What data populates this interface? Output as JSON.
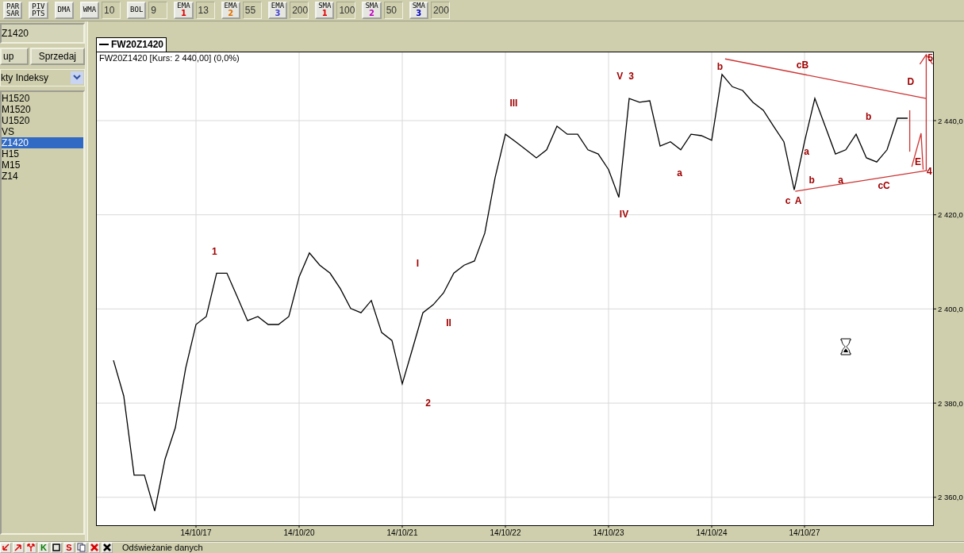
{
  "toolbar": {
    "indicators": [
      {
        "lines": [
          "PAR",
          "SAR"
        ]
      },
      {
        "lines": [
          "PIV",
          "PTS"
        ]
      },
      {
        "lines": [
          "DMA"
        ]
      },
      {
        "lines": [
          "WMA"
        ],
        "value": "10"
      },
      {
        "lines": [
          "BOL"
        ],
        "value": "9"
      },
      {
        "lines": [
          "EMA"
        ],
        "index": "1",
        "color": "#e00000",
        "value": "13"
      },
      {
        "lines": [
          "EMA"
        ],
        "index": "2",
        "color": "#e07000",
        "value": "55"
      },
      {
        "lines": [
          "EMA"
        ],
        "index": "3",
        "color": "#4040d0",
        "value": "200"
      },
      {
        "lines": [
          "SMA"
        ],
        "index": "1",
        "color": "#e00000",
        "value": "100"
      },
      {
        "lines": [
          "SMA"
        ],
        "index": "2",
        "color": "#c000c0",
        "value": "50"
      },
      {
        "lines": [
          "SMA"
        ],
        "index": "3",
        "color": "#0000c0",
        "value": "200"
      }
    ]
  },
  "sidebar": {
    "symbol": "Z1420",
    "buttons": [
      "up",
      "Sprzedaj"
    ],
    "dropdown": "kty Indeksy",
    "instruments": [
      {
        "label": "H1520",
        "selected": false
      },
      {
        "label": "M1520",
        "selected": false
      },
      {
        "label": "U1520",
        "selected": false
      },
      {
        "label": "VS",
        "selected": false
      },
      {
        "label": "Z1420",
        "selected": true
      },
      {
        "label": "H15",
        "selected": false
      },
      {
        "label": "M15",
        "selected": false
      },
      {
        "label": "Z14",
        "selected": false
      }
    ]
  },
  "chart": {
    "chart_data": {
      "type": "line",
      "title": "FW20Z1420 [Kurs: 2 440,00] (0,0%)",
      "categories": [
        null,
        null,
        null,
        null,
        null,
        null,
        null,
        null,
        "14/10/17",
        null,
        null,
        null,
        null,
        null,
        null,
        null,
        null,
        null,
        "14/10/20",
        null,
        null,
        null,
        null,
        null,
        null,
        null,
        null,
        null,
        "14/10/21",
        null,
        null,
        null,
        null,
        null,
        null,
        null,
        null,
        null,
        "14/10/22",
        null,
        null,
        null,
        null,
        null,
        null,
        null,
        null,
        null,
        "14/10/23",
        null,
        null,
        null,
        null,
        null,
        null,
        null,
        null,
        null,
        "14/10/24",
        null,
        null,
        null,
        null,
        null,
        null,
        null,
        null,
        "14/10/27",
        null,
        null,
        null,
        null,
        null,
        null,
        null,
        null,
        null,
        null
      ],
      "series": [
        {
          "name": "FW20Z1420",
          "color": "#000000",
          "values": [
            2389.1,
            2381.5,
            2364.7,
            2364.7,
            2357.1,
            2368.1,
            2374.8,
            2387.4,
            2396.7,
            2398.4,
            2407.6,
            2407.6,
            2402.6,
            2397.5,
            2398.4,
            2396.7,
            2396.7,
            2398.4,
            2406.8,
            2411.9,
            2409.3,
            2407.6,
            2404.3,
            2400.1,
            2399.2,
            2401.8,
            2395.0,
            2393.3,
            2384.1,
            2391.6,
            2399.2,
            2400.9,
            2403.4,
            2407.6,
            2409.3,
            2410.2,
            2416.1,
            2427.9,
            2437.1,
            2435.5,
            2433.8,
            2432.1,
            2433.8,
            2438.8,
            2437.1,
            2437.1,
            2433.8,
            2432.9,
            2429.6,
            2423.7,
            2444.7,
            2443.9,
            2444.2,
            2434.6,
            2435.5,
            2433.8,
            2437.1,
            2436.8,
            2435.8,
            2449.8,
            2447.2,
            2446.4,
            2443.9,
            2442.2,
            2438.8,
            2435.5,
            2425.3,
            2435.5,
            2444.7,
            2438.8,
            2432.9,
            2433.8,
            2437.1,
            2432.1,
            2431.2,
            2433.8,
            2440.5,
            2440.5
          ]
        }
      ],
      "ylim": [
        2354.07,
        2454.66
      ],
      "grid": true,
      "yticks": [
        {
          "value": 2360,
          "label": "2 360,0"
        },
        {
          "value": 2380,
          "label": "2 380,0"
        },
        {
          "value": 2400,
          "label": "2 400,0"
        },
        {
          "value": 2420,
          "label": "2 420,0"
        },
        {
          "value": 2440,
          "label": "2 440,0"
        }
      ]
    },
    "wave_labels": [
      "1",
      "2",
      "I",
      "II",
      "III",
      "IV",
      "V",
      "3",
      "a",
      "b",
      "a",
      "c",
      "A",
      "b",
      "cB",
      "a",
      "b",
      "cC",
      "D",
      "E",
      "4",
      "5"
    ]
  },
  "status_bar": {
    "tools": [
      {
        "kind": "arrow-down"
      },
      {
        "kind": "arrow-up"
      },
      {
        "kind": "fork"
      },
      {
        "kind": "letter",
        "text": "K",
        "color": "#008000"
      },
      {
        "kind": "frame"
      },
      {
        "kind": "letter",
        "text": "S",
        "color": "#d00000"
      },
      {
        "kind": "copy"
      },
      {
        "kind": "delete"
      },
      {
        "kind": "delete-one"
      }
    ],
    "message": "Odświeżanie danych"
  }
}
